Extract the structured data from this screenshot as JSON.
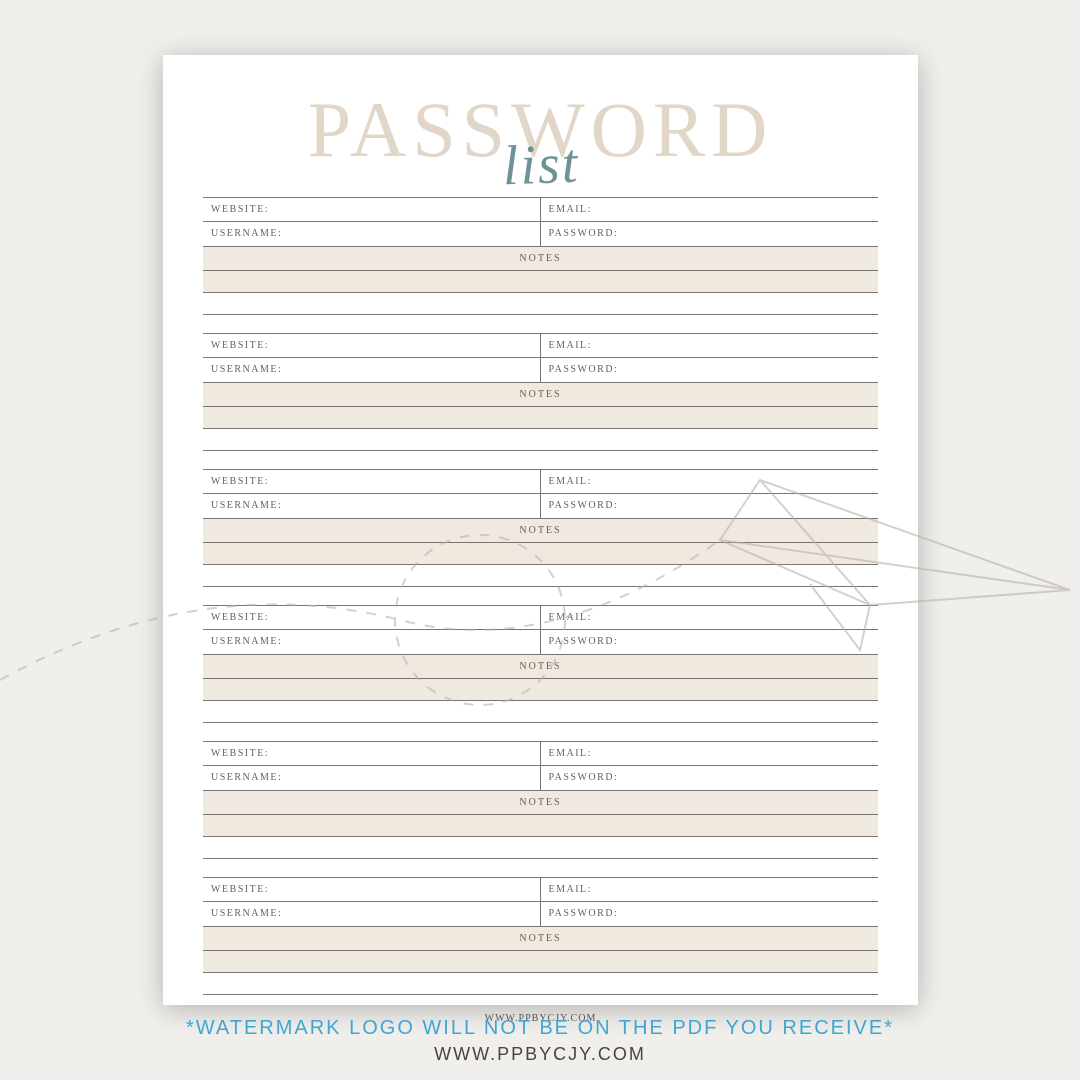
{
  "title": {
    "main": "PASSWORD",
    "script": "list"
  },
  "labels": {
    "website": "WEBSITE:",
    "email": "EMAIL:",
    "username": "USERNAME:",
    "password": "PASSWORD:",
    "notes": "NOTES"
  },
  "footer_url": "WWW.PPBYCJY.COM",
  "caption": {
    "line1": "*WATERMARK LOGO WILL NOT BE ON THE PDF YOU RECEIVE*",
    "line2": "WWW.PPBYCJY.COM"
  },
  "entry_count": 6
}
